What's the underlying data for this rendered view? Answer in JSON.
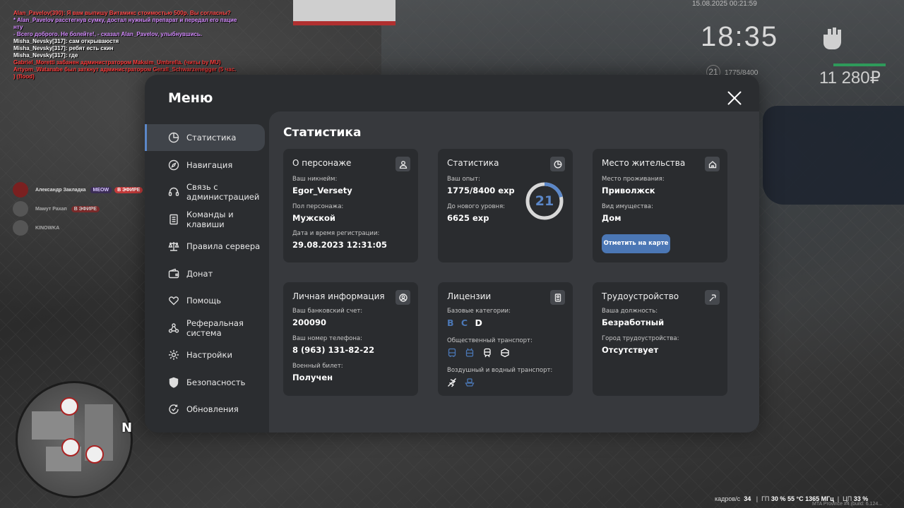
{
  "chat": [
    {
      "text": "Alan_Pavelov(390): Я вам выпишу Витамикс стоимостью 500р. Вы согласны?",
      "color": "#ff4a4a"
    },
    {
      "text": "* Alan_Pavelov расстегнув сумку, достал нужный препарат и передал его пацие нту",
      "color": "#d58cff"
    },
    {
      "text": "- Всего доброго. Не болейте!, - сказал Alan_Pavelov, улыбнувшись.",
      "color": "#d58cff"
    },
    {
      "text": "Misha_Nevsky[317]: сам открываюстя",
      "color": "#ffffff"
    },
    {
      "text": "Misha_Nevsky[317]: ребят есть скин",
      "color": "#ffffff"
    },
    {
      "text": "Misha_Nevsky[317]: где",
      "color": "#ffffff"
    },
    {
      "text": "Gabriel_Moretti забанен администратором Maksim_Umbrella. (читы by MU)",
      "color": "#ff3b3b"
    },
    {
      "text": "Artyom_Watanabe был заткнут администратором Gerall_Schwarzenegger (5 час. ) (flood)",
      "color": "#ff3b3b"
    }
  ],
  "hud": {
    "date": "15.08.2025 00:21:59",
    "time": "18:35",
    "level": "21",
    "exp": "1775/8400",
    "money": "11 280₽"
  },
  "voice": [
    {
      "name": "Александр Закладка",
      "tag": "MEOW",
      "air": "В ЭФИРЕ"
    },
    {
      "name": "Мамут Рахап",
      "tag": "",
      "air": "В ЭФИРЕ"
    },
    {
      "name": "KINOWKA",
      "tag": "",
      "air": ""
    }
  ],
  "status": {
    "fps_label": "кадров/с",
    "fps": "34",
    "gpu_label": "ГП",
    "gpu_load": "30 %",
    "gpu_temp": "55 °C",
    "gpu_clock": "1365 МГц",
    "cpu_label": "ЦП",
    "cpu_load": "33 %",
    "build": "MTA Province #4 (build: 6.124..."
  },
  "menu": {
    "title": "Меню",
    "content_title": "Статистика",
    "nav": [
      {
        "label": "Статистика",
        "icon": "pie-chart-icon",
        "active": true
      },
      {
        "label": "Навигация",
        "icon": "compass-icon"
      },
      {
        "label": "Связь с администрацией",
        "icon": "headset-icon"
      },
      {
        "label": "Команды и клавиши",
        "icon": "document-icon"
      },
      {
        "label": "Правила сервера",
        "icon": "scales-icon"
      },
      {
        "label": "Донат",
        "icon": "wallet-icon"
      },
      {
        "label": "Помощь",
        "icon": "heart-hand-icon"
      },
      {
        "label": "Реферальная система",
        "icon": "network-icon"
      },
      {
        "label": "Настройки",
        "icon": "gear-icon"
      },
      {
        "label": "Безопасность",
        "icon": "shield-icon"
      },
      {
        "label": "Обновления",
        "icon": "refresh-check-icon"
      }
    ],
    "cards": {
      "character": {
        "title": "О персонаже",
        "nick_label": "Ваш никнейм:",
        "nick": "Egor_Versety",
        "gender_label": "Пол персонажа:",
        "gender": "Мужской",
        "reg_label": "Дата и время регистрации:",
        "reg": "29.08.2023 12:31:05"
      },
      "stats": {
        "title": "Статистика",
        "exp_label": "Ваш опыт:",
        "exp": "1775/8400 exp",
        "next_label": "До нового уровня:",
        "next": "6625 exp",
        "level": "21",
        "progress": 0.211
      },
      "residence": {
        "title": "Место жительства",
        "place_label": "Место проживания:",
        "place": "Приволжск",
        "prop_label": "Вид имущества:",
        "prop": "Дом",
        "button": "Отметить на карте"
      },
      "personal": {
        "title": "Личная информация",
        "bank_label": "Ваш банковский счет:",
        "bank": "200090",
        "phone_label": "Ваш номер телефона:",
        "phone": "8 (963) 131-82-22",
        "military_label": "Военный билет:",
        "military": "Получен"
      },
      "licenses": {
        "title": "Лицензии",
        "base_label": "Базовые категории:",
        "cats": [
          "B",
          "C",
          "D"
        ],
        "public_label": "Общественный транспорт:",
        "air_label": "Воздушный и водный транспорт:"
      },
      "job": {
        "title": "Трудоустройство",
        "pos_label": "Ваша должность:",
        "pos": "Безработный",
        "city_label": "Город трудоустройства:",
        "city": "Отсутствует"
      }
    }
  },
  "colors": {
    "accent": "#5b87c8",
    "active_cat": "#4b77b5",
    "inactive_cat": "#ffffff"
  }
}
